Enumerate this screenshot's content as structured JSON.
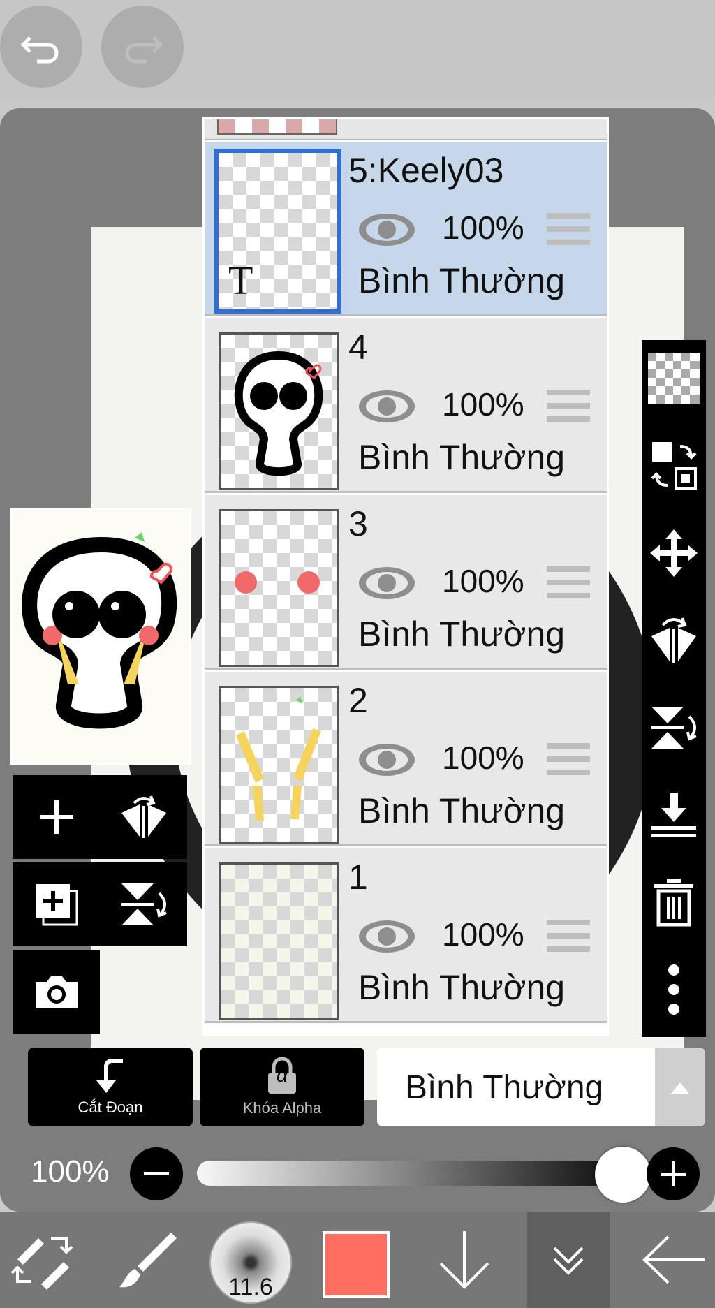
{
  "layers": [
    {
      "name": "5:Keely03",
      "opacity": "100%",
      "blend": "Bình Thường",
      "selected": true,
      "thumb_letter": "T"
    },
    {
      "name": "4",
      "opacity": "100%",
      "blend": "Bình Thường",
      "selected": false
    },
    {
      "name": "3",
      "opacity": "100%",
      "blend": "Bình Thường",
      "selected": false
    },
    {
      "name": "2",
      "opacity": "100%",
      "blend": "Bình Thường",
      "selected": false
    },
    {
      "name": "1",
      "opacity": "100%",
      "blend": "Bình Thường",
      "selected": false
    }
  ],
  "actions": {
    "clip_label": "Cắt Đoạn",
    "alpha_lock_label": "Khóa Alpha",
    "alpha_symbol": "α",
    "blend_mode": "Bình Thường"
  },
  "opacity_slider": {
    "label": "100%",
    "value_fraction": 1.0
  },
  "brush_size": "11.6",
  "colors": {
    "primary_color": "#ff6f61",
    "selected_layer_bg": "#c7d7ea",
    "selected_layer_border": "#2f6fd6"
  },
  "icons": {
    "undo": "undo-icon",
    "redo": "redo-icon",
    "right_tools": [
      "transparency-checker-icon",
      "swap-layer-icon",
      "move-icon",
      "flip-horizontal-icon",
      "flip-vertical-icon",
      "merge-down-icon",
      "trash-icon",
      "more-vertical-icon"
    ],
    "left_tools": [
      "add-layer-icon",
      "flip-horizontal-rotate-icon",
      "duplicate-layer-icon",
      "flip-vertical-rotate-icon",
      "camera-icon"
    ],
    "bottom": [
      "transform-tool-icon",
      "brush-icon",
      "brush-size-icon",
      "color-swatch-icon",
      "arrow-down-icon",
      "layers-icon",
      "back-arrow-icon"
    ]
  }
}
